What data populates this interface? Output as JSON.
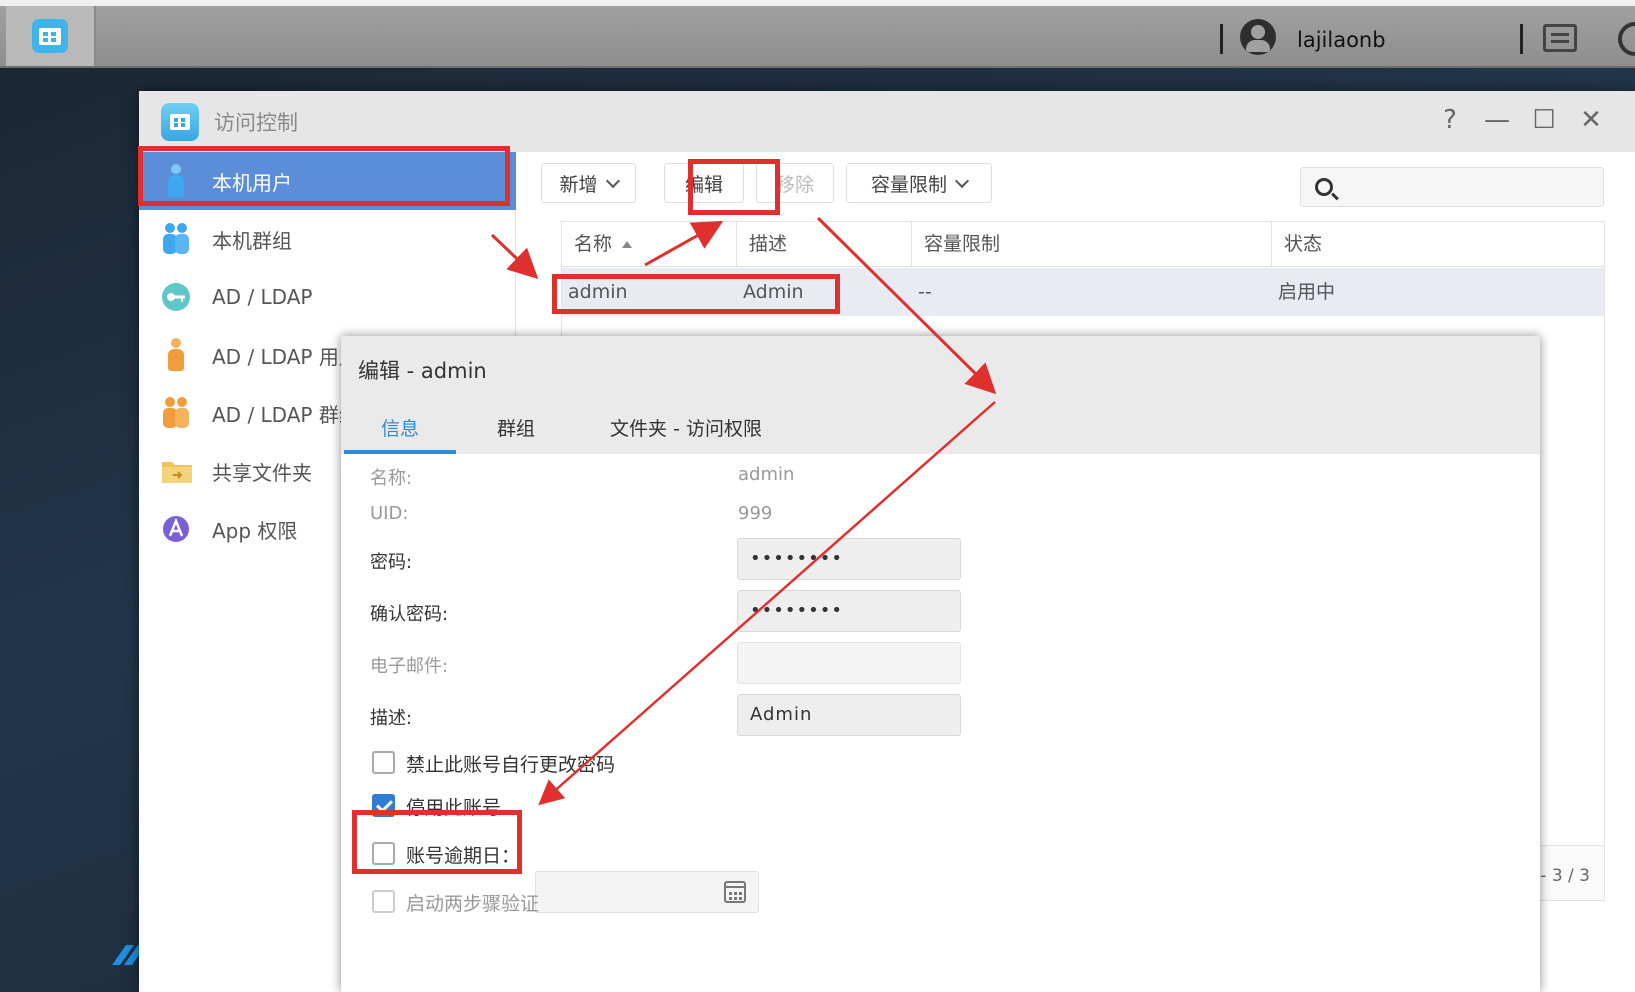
{
  "taskbar": {
    "username": "lajilaonb"
  },
  "window": {
    "title": "访问控制",
    "controls": [
      "?",
      "—",
      "☐",
      "✕"
    ]
  },
  "sidebar": {
    "items": [
      {
        "label": "本机用户",
        "icon": "user-icon",
        "active": true
      },
      {
        "label": "本机群组",
        "icon": "group-icon",
        "active": false
      },
      {
        "label": "AD / LDAP",
        "icon": "key-icon",
        "active": false
      },
      {
        "label": "AD / LDAP 用户",
        "icon": "user-icon",
        "active": false
      },
      {
        "label": "AD / LDAP 群组",
        "icon": "group-icon",
        "active": false
      },
      {
        "label": "共享文件夹",
        "icon": "folder-icon",
        "active": false
      },
      {
        "label": "App 权限",
        "icon": "app-icon",
        "active": false
      }
    ]
  },
  "toolbar": {
    "add_label": "新增",
    "edit_label": "编辑",
    "remove_label": "移除",
    "quota_label": "容量限制"
  },
  "table": {
    "columns": [
      "名称",
      "描述",
      "容量限制",
      "状态"
    ],
    "rows": [
      {
        "name": "admin",
        "description": "Admin",
        "quota": "--",
        "status": "启用中"
      }
    ],
    "pager": "- 3 / 3"
  },
  "modal": {
    "title": "编辑 - admin",
    "tabs": [
      "信息",
      "群组",
      "文件夹 - 访问权限"
    ],
    "active_tab": 0,
    "fields": {
      "name_label": "名称:",
      "name_value": "admin",
      "uid_label": "UID:",
      "uid_value": "999",
      "password_label": "密码:",
      "password_value": "••••••••",
      "confirm_label": "确认密码:",
      "confirm_value": "••••••••",
      "email_label": "电子邮件:",
      "email_value": "",
      "desc_label": "描述:",
      "desc_value": "Admin"
    },
    "checkboxes": [
      {
        "label": "禁止此账号自行更改密码",
        "checked": false
      },
      {
        "label": "停用此账号",
        "checked": true
      },
      {
        "label": "账号逾期日：",
        "checked": false
      },
      {
        "label": "启动两步骤验证",
        "checked": false
      }
    ]
  },
  "colors": {
    "accent": "#2e8bd6",
    "sidebar_active": "#5b8dd8",
    "annotation_red": "#e0302e"
  }
}
